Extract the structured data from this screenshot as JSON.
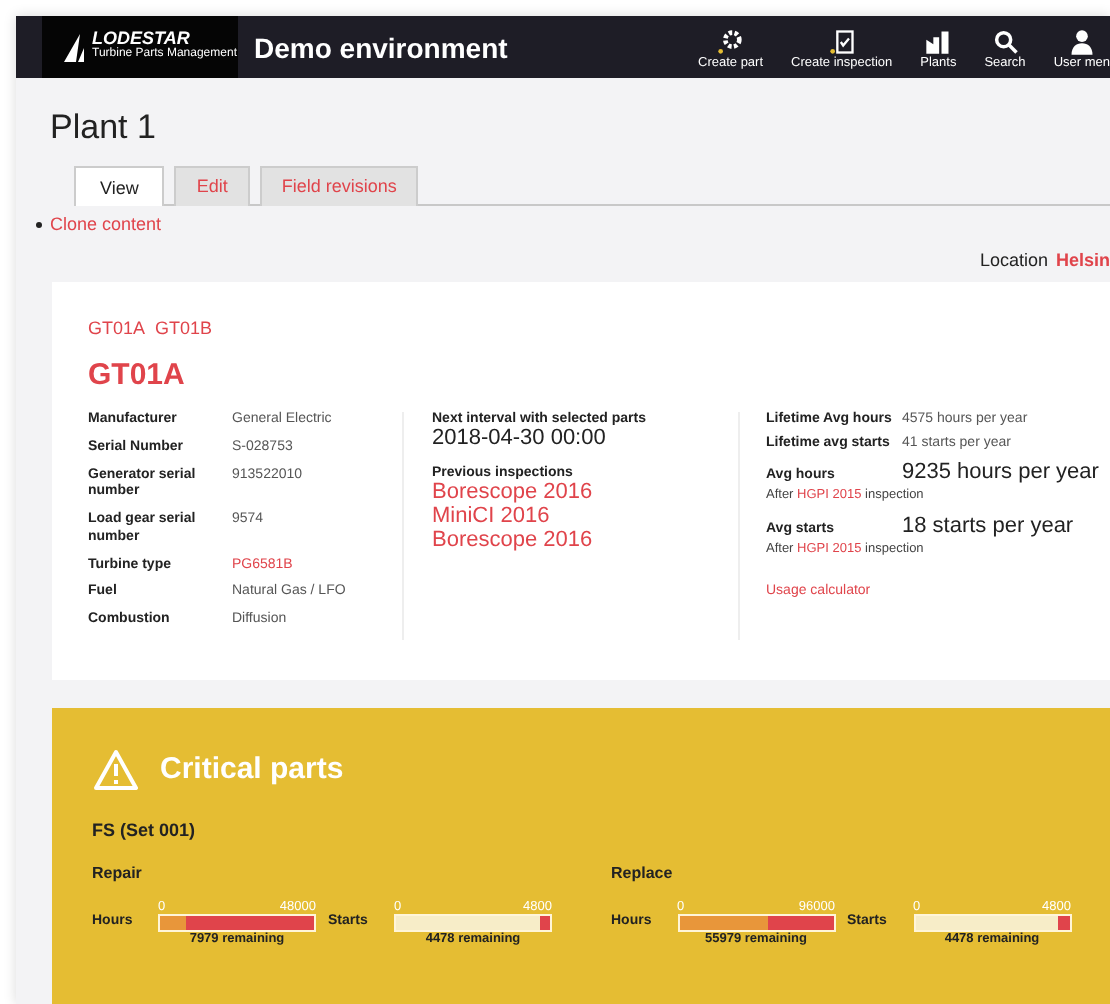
{
  "header": {
    "logo_name": "LODESTAR",
    "logo_tagline": "Turbine Parts Management",
    "environment": "Demo environment",
    "actions": [
      {
        "label": "Create part"
      },
      {
        "label": "Create inspection"
      },
      {
        "label": "Plants"
      },
      {
        "label": "Search"
      },
      {
        "label": "User men"
      }
    ]
  },
  "page_title": "Plant 1",
  "tabs": [
    {
      "label": "View",
      "selected": true
    },
    {
      "label": "Edit",
      "selected": false
    },
    {
      "label": "Field revisions",
      "selected": false
    }
  ],
  "links": [
    "Clone content"
  ],
  "location": {
    "label": "Location",
    "value": "Helsin"
  },
  "unit_links": [
    "GT01A",
    "GT01B"
  ],
  "unit_title": "GT01A",
  "properties": [
    {
      "label": "Manufacturer",
      "value": "General Electric",
      "link": false
    },
    {
      "label": "Serial Number",
      "value": "S-028753",
      "link": false
    },
    {
      "label": "Generator serial number",
      "value": "913522010",
      "link": false
    },
    {
      "label": "Load gear serial number",
      "value": "9574",
      "link": false
    },
    {
      "label": "Turbine type",
      "value": "PG6581B",
      "link": true
    },
    {
      "label": "Fuel",
      "value": "Natural Gas / LFO",
      "link": false
    },
    {
      "label": "Combustion",
      "value": "Diffusion",
      "link": false
    }
  ],
  "next_interval": {
    "label": "Next interval with selected parts",
    "value": "2018-04-30 00:00"
  },
  "previous_inspections": {
    "label": "Previous inspections",
    "items": [
      "Borescope 2016",
      "MiniCI 2016",
      "Borescope 2016"
    ]
  },
  "usage": [
    {
      "kind": "small",
      "label": "Lifetime Avg hours",
      "value": "4575 hours per year"
    },
    {
      "kind": "small",
      "label": "Lifetime avg starts",
      "value": "41 starts per year"
    },
    {
      "kind": "large",
      "label": "Avg hours",
      "value": "9235 hours per year",
      "note_before": "After",
      "note_link": "HGPI 2015",
      "note_after": "inspection"
    },
    {
      "kind": "large",
      "label": "Avg starts",
      "value": "18 starts per year",
      "note_before": "After",
      "note_link": "HGPI 2015",
      "note_after": "inspection"
    }
  ],
  "usage_link": "Usage calculator",
  "critical": {
    "title": "Critical parts",
    "set_title": "FS (Set 001)",
    "groups": [
      {
        "title": "Repair",
        "meters": [
          {
            "label": "Hours",
            "min": "0",
            "max": "48000",
            "level": 0.83,
            "warn": true,
            "remaining": "7979 remaining"
          },
          {
            "label": "Starts",
            "min": "0",
            "max": "4800",
            "level": 0.07,
            "warn": false,
            "remaining": "4478 remaining"
          }
        ]
      },
      {
        "title": "Replace",
        "meters": [
          {
            "label": "Hours",
            "min": "0",
            "max": "96000",
            "level": 0.42,
            "warn": true,
            "remaining": "55979 remaining"
          },
          {
            "label": "Starts",
            "min": "0",
            "max": "4800",
            "level": 0.07,
            "warn": false,
            "remaining": "4478 remaining"
          }
        ]
      }
    ]
  }
}
